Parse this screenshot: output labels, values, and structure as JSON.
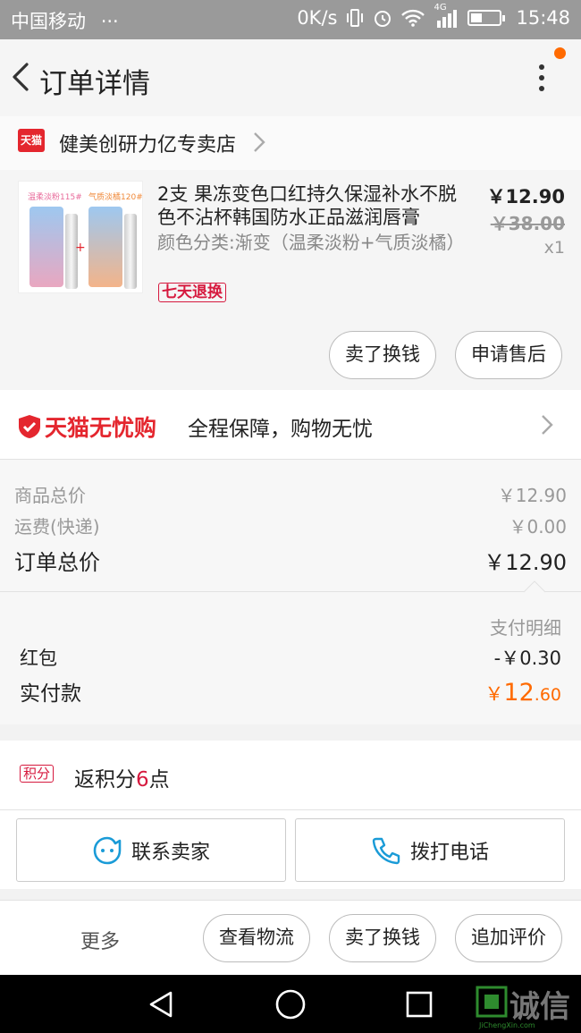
{
  "status_bar": {
    "carrier": "中国移动",
    "dots": "···",
    "net_speed": "0K/s",
    "network_type": "4G",
    "time": "15:48"
  },
  "nav": {
    "title": "订单详情"
  },
  "shop": {
    "badge": "天猫",
    "name": "健美创研力亿专卖店"
  },
  "product": {
    "title": "2支 果冻变色口红持久保湿补水不脱色不沾杯韩国防水正品滋润唇膏",
    "sku": "颜色分类:渐变（温柔淡粉+气质淡橘）",
    "return_tag": "七天退换",
    "price": "￥12.90",
    "original_price": "￥38.00",
    "quantity": "x1",
    "thumb": {
      "left_label": "温柔淡粉",
      "left_code": "115#",
      "right_label": "气质淡橘",
      "right_code": "120#",
      "plus": "+"
    }
  },
  "product_actions": {
    "sell_swap": "卖了换钱",
    "after_sales": "申请售后"
  },
  "worry_free": {
    "logo_text": "天猫无忧购",
    "description": "全程保障，购物无忧"
  },
  "summary": {
    "goods_total_label": "商品总价",
    "goods_total_value": "￥12.90",
    "shipping_label": "运费(快递)",
    "shipping_value": "￥0.00",
    "order_total_label": "订单总价",
    "order_total_value": "￥12.90"
  },
  "payment": {
    "detail_label": "支付明细",
    "red_packet_label": "红包",
    "red_packet_value": "-￥0.30",
    "paid_label": "实付款",
    "paid_currency": "￥",
    "paid_int": "12",
    "paid_dec": ".60"
  },
  "points": {
    "badge": "积分",
    "text_prefix": "返积分",
    "count": "6",
    "text_suffix": "点"
  },
  "contact": {
    "seller": "联系卖家",
    "call": "拨打电话"
  },
  "bottom_actions": {
    "more": "更多",
    "logistics": "查看物流",
    "sell_swap": "卖了换钱",
    "add_review": "追加评价"
  },
  "watermark": {
    "text": "诚信",
    "sub": "JiChengXin.com"
  },
  "colors": {
    "accent_orange": "#ff6a00",
    "tmall_red": "#e4262e",
    "tag_red": "#d6193e",
    "link_blue": "#1a9bd7"
  }
}
